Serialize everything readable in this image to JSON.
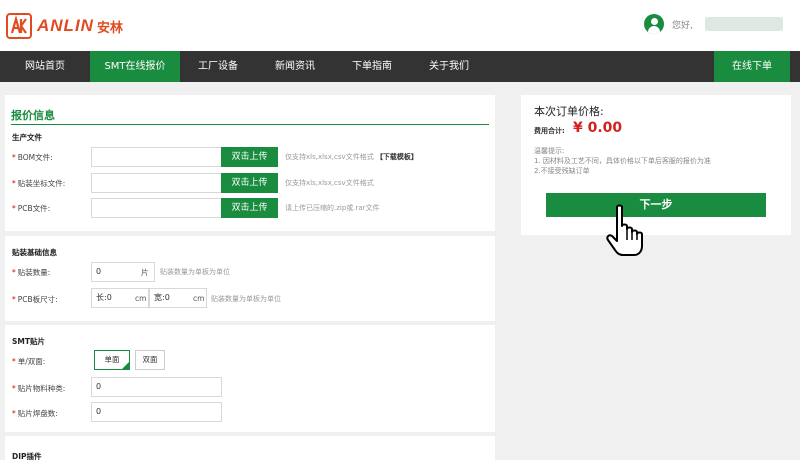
{
  "brand": {
    "logo_text": "ANLIN",
    "logo_cn": "安林",
    "accent": "#1a8c3f",
    "logo_color": "#e14b22"
  },
  "header": {
    "greeting": "您好,"
  },
  "nav": {
    "items": [
      {
        "label": "网站首页",
        "active": false
      },
      {
        "label": "SMT在线报价",
        "active": true
      },
      {
        "label": "工厂设备",
        "active": false
      },
      {
        "label": "新闻资讯",
        "active": false
      },
      {
        "label": "下单指南",
        "active": false
      },
      {
        "label": "关于我们",
        "active": false
      }
    ],
    "cta": "在线下单"
  },
  "quote": {
    "title": "报价信息",
    "production_files": {
      "title": "生产文件",
      "rows": [
        {
          "label": "BOM文件:",
          "button": "双击上传",
          "hint": "仅支持xls,xlsx,csv文件格式",
          "hint_link": "【下载模板】"
        },
        {
          "label": "贴装坐标文件:",
          "button": "双击上传",
          "hint": "仅支持xls,xlsx,csv文件格式"
        },
        {
          "label": "PCB文件:",
          "button": "双击上传",
          "hint": "请上传已压缩的.zip或.rar文件"
        }
      ]
    },
    "mount_info": {
      "title": "贴装基础信息",
      "quantity_label": "贴装数量:",
      "quantity_value": "0",
      "quantity_unit": "片",
      "quantity_hint": "贴装数量为单板为单位",
      "pcb_size_label": "PCB板尺寸:",
      "length_prefix": "长:",
      "length_value": "0",
      "length_unit": "cm",
      "width_prefix": "宽:",
      "width_value": "0",
      "width_unit": "cm",
      "size_hint": "贴装数量为单板为单位"
    },
    "smt": {
      "title": "SMT贴片",
      "side_label": "单/双面:",
      "side_options": [
        "单面",
        "双面"
      ],
      "side_selected": "单面",
      "material_label": "贴片物料种类:",
      "material_value": "0",
      "pads_label": "贴片焊盘数:",
      "pads_value": "0"
    },
    "dip": {
      "title": "DIP插件"
    }
  },
  "price": {
    "title": "本次订单价格:",
    "total_label": "费用合计:",
    "total_value": "¥ 0.00",
    "tips_title": "温馨提示:",
    "tips": [
      "1. 因材料及工艺不同，具体价格以下单后客服的报价为准",
      "2.不接受残缺订单"
    ],
    "next_button": "下一步"
  }
}
